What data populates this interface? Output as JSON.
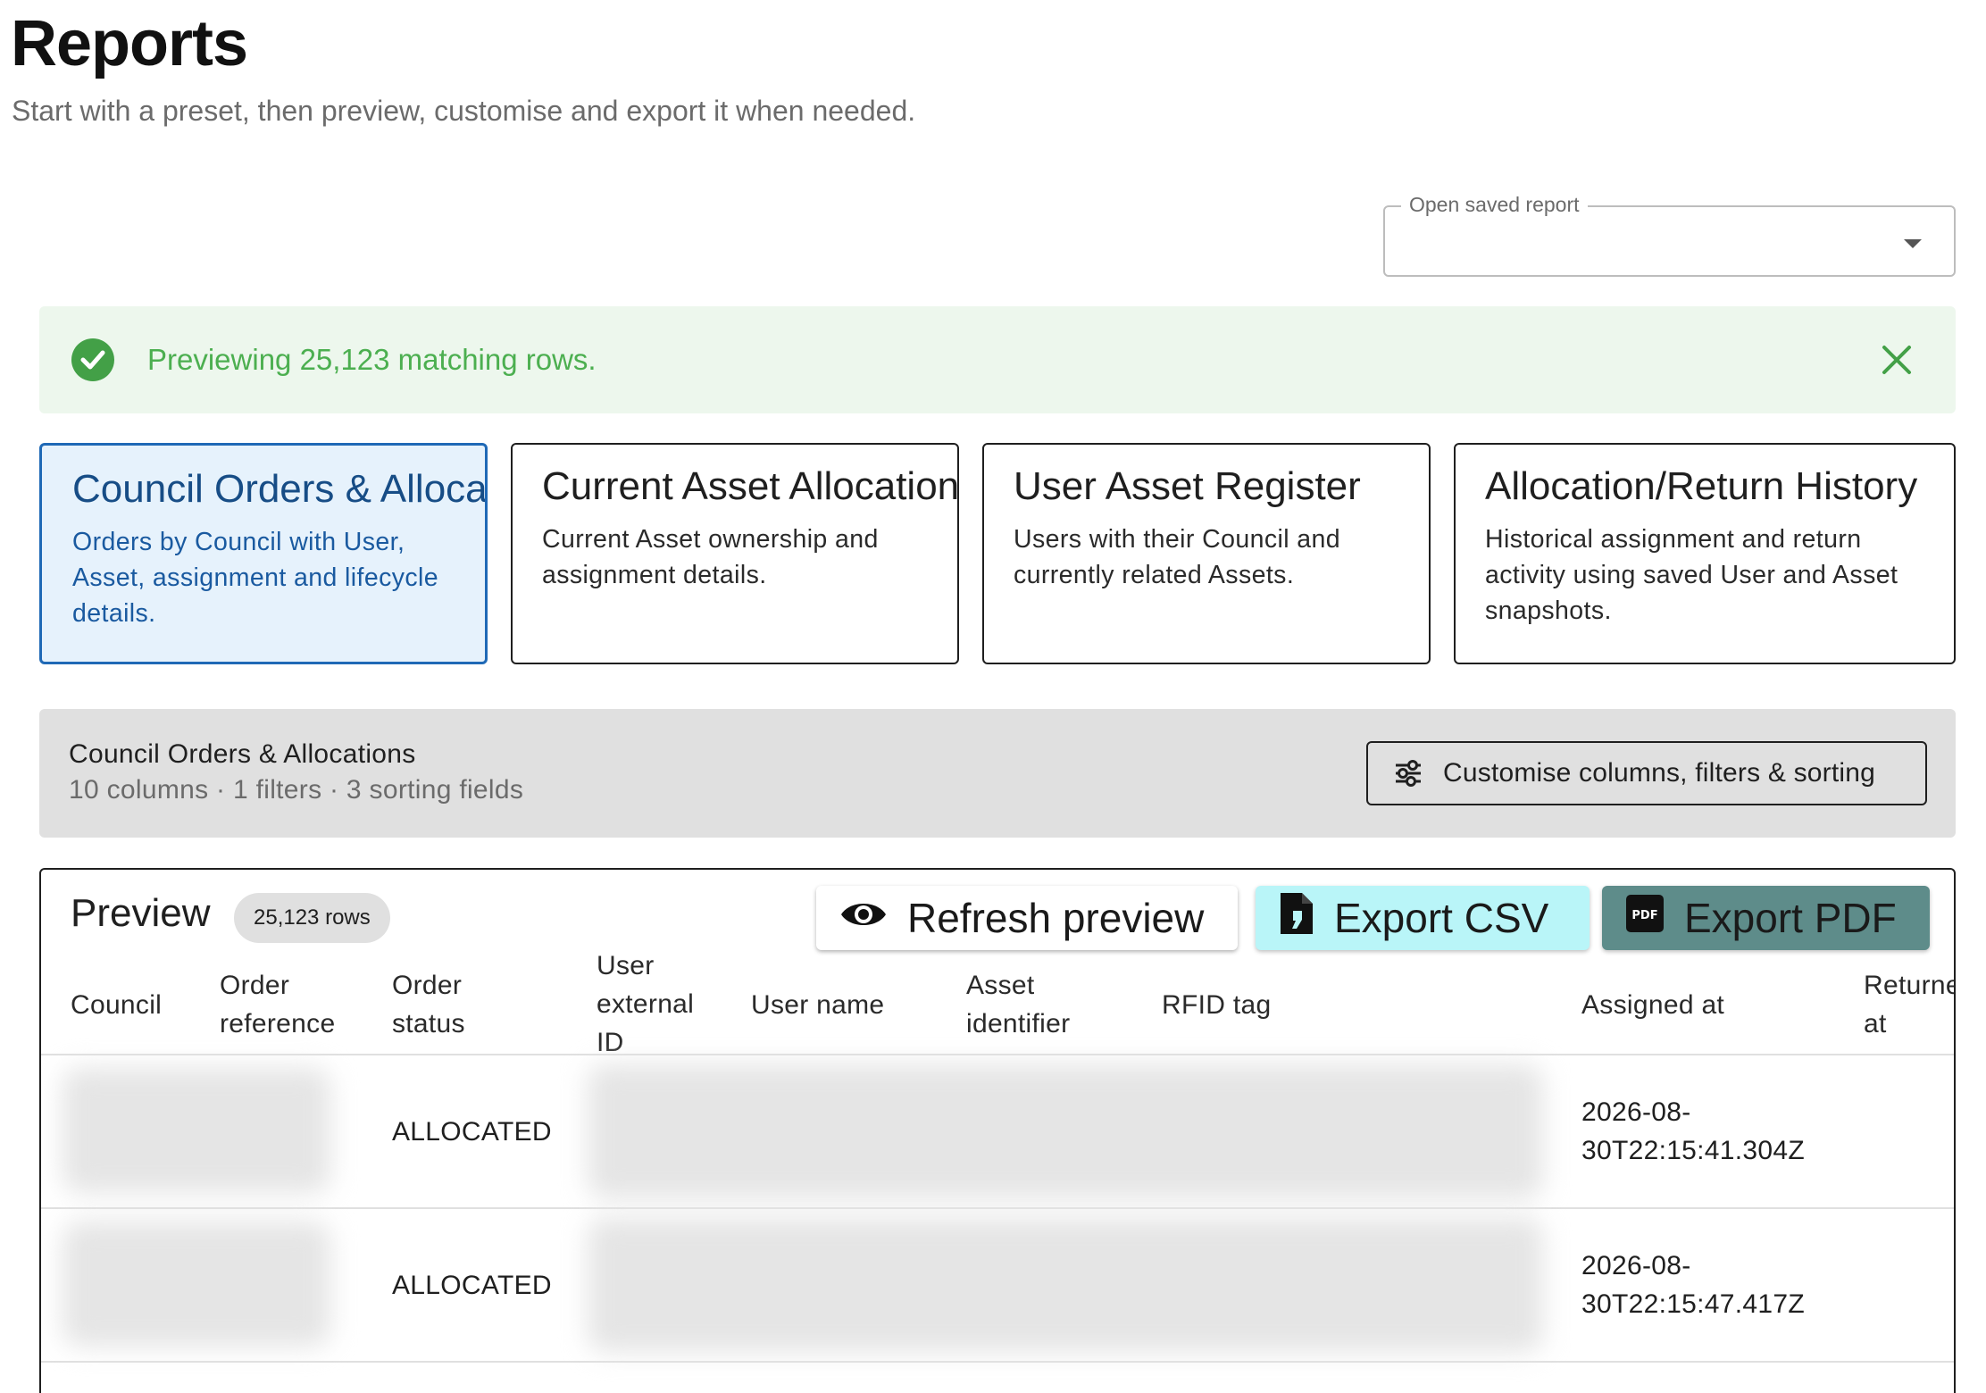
{
  "page": {
    "title": "Reports",
    "subtitle": "Start with a preset, then preview, customise and export it when needed."
  },
  "saved_report": {
    "label": "Open saved report",
    "value": ""
  },
  "alert": {
    "message": "Previewing 25,123 matching rows.",
    "color": "#4caf50"
  },
  "presets": [
    {
      "title": "Council Orders & Allocations",
      "description": "Orders by Council with User, Asset, assignment and lifecycle details.",
      "selected": true
    },
    {
      "title": "Current Asset Allocations",
      "description": "Current Asset ownership and assignment details.",
      "selected": false
    },
    {
      "title": "User Asset Register",
      "description": "Users with their Council and currently related Assets.",
      "selected": false
    },
    {
      "title": "Allocation/Return History",
      "description": "Historical assignment and return activity using saved User and Asset snapshots.",
      "selected": false
    }
  ],
  "config": {
    "name": "Council Orders & Allocations",
    "summary": "10 columns · 1 filters · 3 sorting fields",
    "customise_label": "Customise columns, filters & sorting"
  },
  "preview": {
    "title": "Preview",
    "row_count": "25,123 rows",
    "refresh_label": "Refresh preview",
    "export_csv_label": "Export CSV",
    "export_pdf_label": "Export PDF",
    "columns": [
      "Council",
      "Order reference",
      "Order status",
      "User external ID",
      "User name",
      "Asset identifier",
      "RFID tag",
      "Assigned at",
      "Returned at"
    ],
    "rows": [
      {
        "order_status": "ALLOCATED",
        "assigned_at": "2026-08-30T22:15:41.304Z"
      },
      {
        "order_status": "ALLOCATED",
        "assigned_at": "2026-08-30T22:15:47.417Z"
      }
    ]
  },
  "colors": {
    "accent": "#1f69b6",
    "success_bg": "#edf7ed",
    "csv_button": "#b9f5f8",
    "pdf_button": "#5e8c8a"
  }
}
